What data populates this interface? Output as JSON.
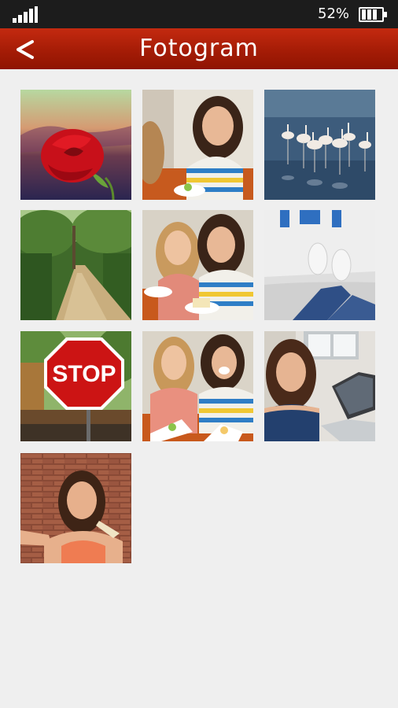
{
  "status_bar": {
    "battery_percent": "52%",
    "signal_icon": "signal-bars-icon",
    "battery_icon": "battery-icon"
  },
  "app_bar": {
    "title": "Fotogram",
    "back_label": "<",
    "color": "#a51c06"
  },
  "photos": [
    {
      "subject": "red-rose",
      "sign_text": ""
    },
    {
      "subject": "woman-selfie-striped-shirt",
      "sign_text": ""
    },
    {
      "subject": "flamingos-in-water",
      "sign_text": ""
    },
    {
      "subject": "garden-path",
      "sign_text": ""
    },
    {
      "subject": "two-women-dessert-selfie",
      "sign_text": ""
    },
    {
      "subject": "feet-on-bed",
      "sign_text": ""
    },
    {
      "subject": "stop-sign",
      "sign_text": "STOP"
    },
    {
      "subject": "two-women-table",
      "sign_text": ""
    },
    {
      "subject": "woman-with-laptop",
      "sign_text": ""
    },
    {
      "subject": "woman-brick-wall-selfie",
      "sign_text": ""
    }
  ]
}
